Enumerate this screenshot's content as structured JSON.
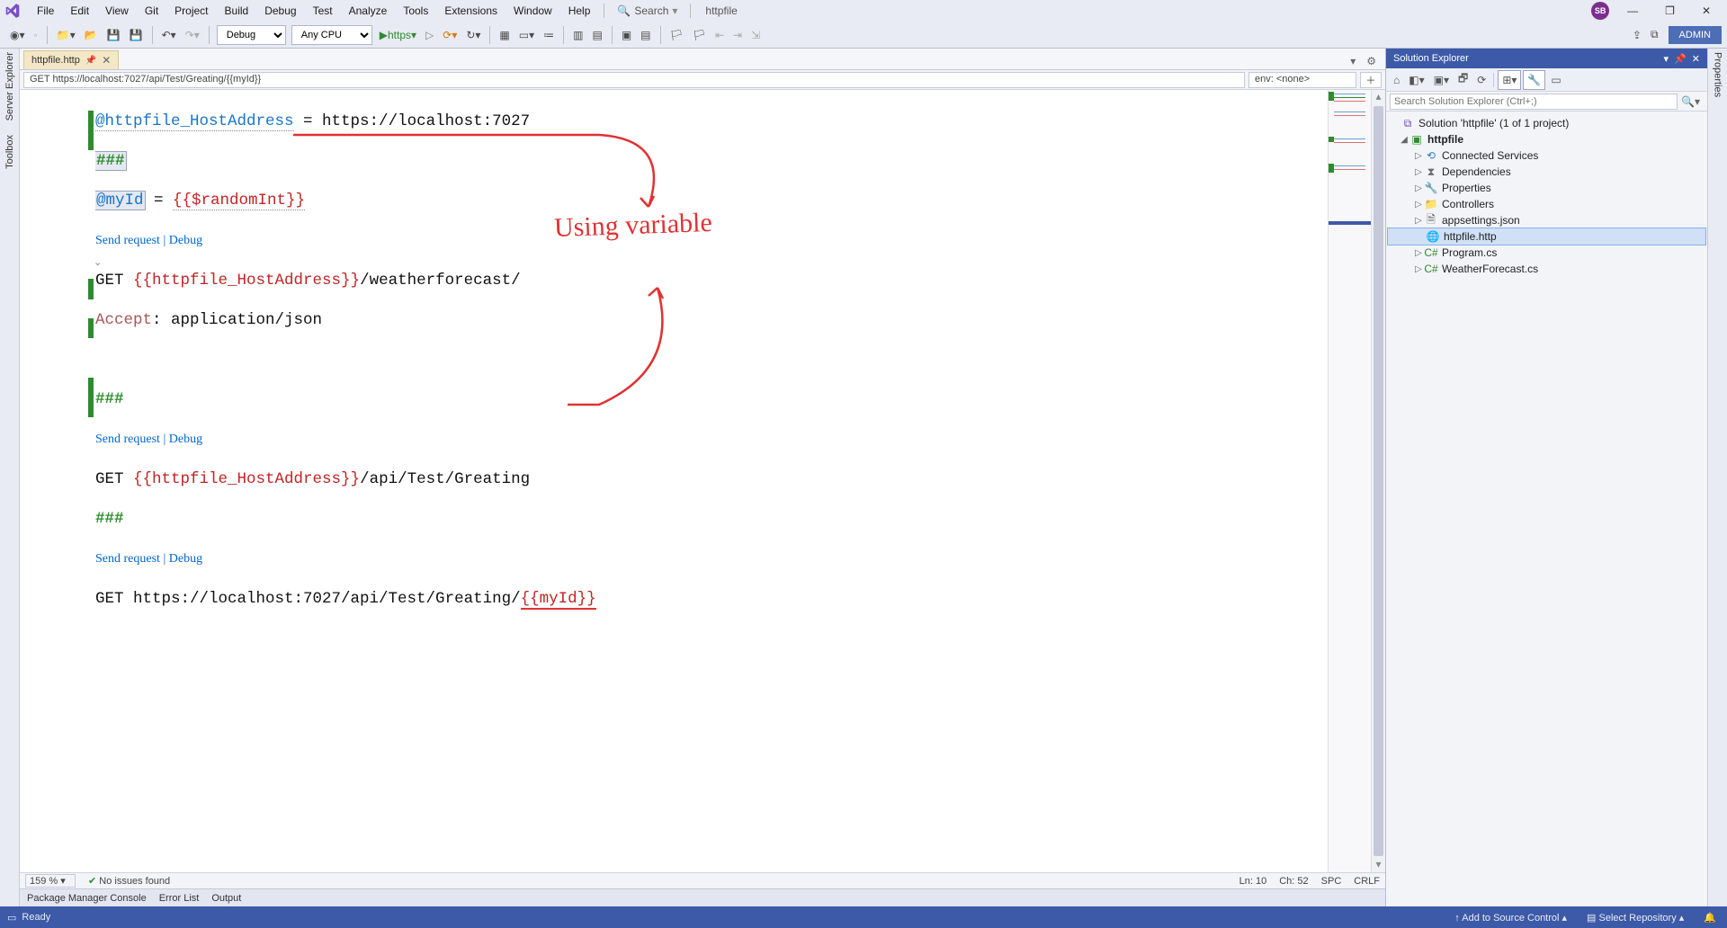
{
  "menu": [
    "File",
    "Edit",
    "View",
    "Git",
    "Project",
    "Build",
    "Debug",
    "Test",
    "Analyze",
    "Tools",
    "Extensions",
    "Window",
    "Help"
  ],
  "search_placeholder": "Search",
  "solution_name_title": "httpfile",
  "user_initials": "SB",
  "admin_label": "ADMIN",
  "toolbar": {
    "config": "Debug",
    "platform": "Any CPU",
    "start_label": "https"
  },
  "left_rail": [
    "Server Explorer",
    "Toolbox"
  ],
  "right_rail_label": "Properties",
  "tab": {
    "name": "httpfile.http"
  },
  "nav": {
    "path": "GET https://localhost:7027/api/Test/Greating/{{myId}}",
    "env": "env: <none>"
  },
  "code": {
    "line1_a": "@httpfile_HostAddress",
    "line1_b": " = https://localhost:7027",
    "sep": "###",
    "line3_a": "@myId",
    "line3_b": " = ",
    "line3_c": "{{$randomInt}}",
    "send": "Send request",
    "debug": "Debug",
    "bar": " | ",
    "get": "GET ",
    "host_tmpl": "{{httpfile_HostAddress}}",
    "path1": "/weatherforecast/",
    "accept_k": "Accept",
    "accept_v": ": application/json",
    "path2": "/api/Test/Greating",
    "line_last_a": "GET https://localhost:7027/api/Test/Greating/",
    "line_last_b": "{{myId}}"
  },
  "annotation": "Using variable",
  "editor_status": {
    "zoom": "159 %",
    "issues": "No issues found",
    "ln": "Ln: 10",
    "ch": "Ch: 52",
    "spc": "SPC",
    "crlf": "CRLF"
  },
  "solution_explorer": {
    "title": "Solution Explorer",
    "search_placeholder": "Search Solution Explorer (Ctrl+;)",
    "solution": "Solution 'httpfile' (1 of 1 project)",
    "project": "httpfile",
    "nodes": {
      "connected": "Connected Services",
      "deps": "Dependencies",
      "props": "Properties",
      "controllers": "Controllers",
      "appsettings": "appsettings.json",
      "httpfile": "httpfile.http",
      "program": "Program.cs",
      "weather": "WeatherForecast.cs"
    }
  },
  "output_tabs": [
    "Package Manager Console",
    "Error List",
    "Output"
  ],
  "status": {
    "ready": "Ready",
    "add_src": "Add to Source Control",
    "select_repo": "Select Repository"
  }
}
